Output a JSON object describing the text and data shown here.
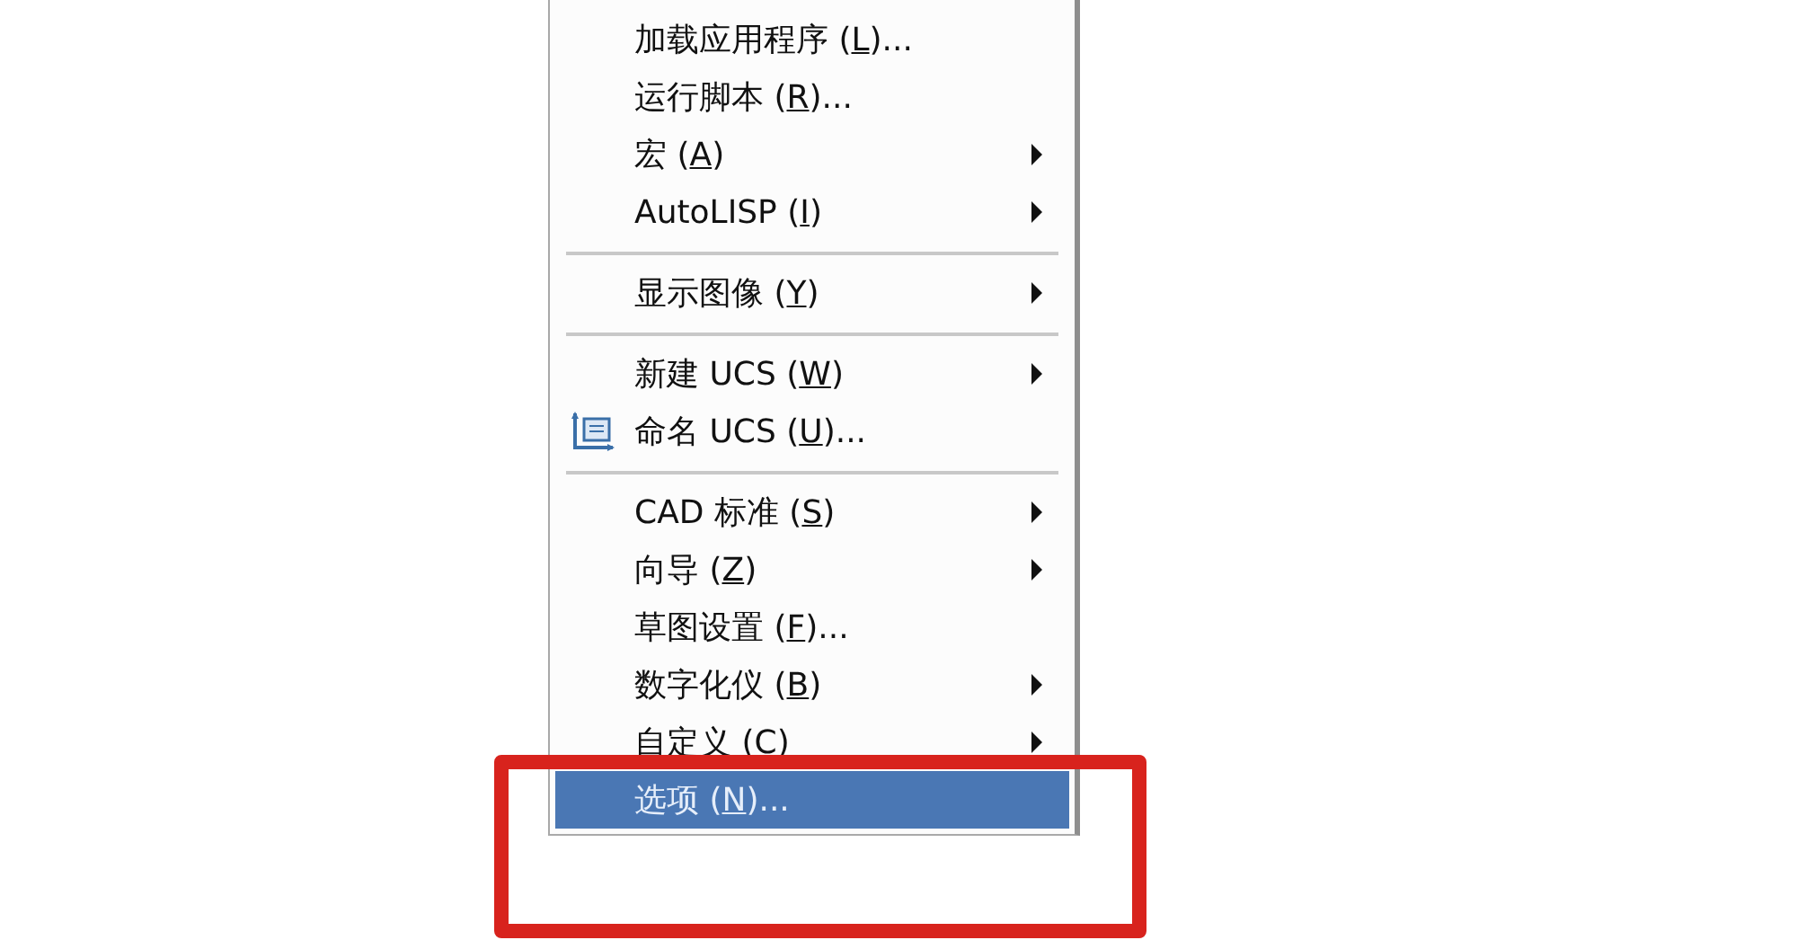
{
  "menu": {
    "items": [
      {
        "kind": "command",
        "text": "加载应用程序 (",
        "key": "L",
        "suffix": ")...",
        "icon": false,
        "selected": false
      },
      {
        "kind": "command",
        "text": "运行脚本 (",
        "key": "R",
        "suffix": ")...",
        "icon": false,
        "selected": false
      },
      {
        "kind": "submenu",
        "text": "宏 (",
        "key": "A",
        "suffix": ")",
        "icon": false,
        "selected": false
      },
      {
        "kind": "submenu",
        "text": "AutoLISP (",
        "key": "I",
        "suffix": ")",
        "icon": false,
        "selected": false
      },
      {
        "kind": "separator"
      },
      {
        "kind": "submenu",
        "text": "显示图像 (",
        "key": "Y",
        "suffix": ")",
        "icon": false,
        "selected": false
      },
      {
        "kind": "separator"
      },
      {
        "kind": "submenu",
        "text": "新建 UCS (",
        "key": "W",
        "suffix": ")",
        "icon": false,
        "selected": false
      },
      {
        "kind": "command",
        "text": "命名 UCS (",
        "key": "U",
        "suffix": ")...",
        "icon": true,
        "selected": false
      },
      {
        "kind": "separator"
      },
      {
        "kind": "submenu",
        "text": "CAD 标准 (",
        "key": "S",
        "suffix": ")",
        "icon": false,
        "selected": false
      },
      {
        "kind": "submenu",
        "text": "向导 (",
        "key": "Z",
        "suffix": ")",
        "icon": false,
        "selected": false
      },
      {
        "kind": "command",
        "text": "草图设置 (",
        "key": "F",
        "suffix": ")...",
        "icon": false,
        "selected": false
      },
      {
        "kind": "submenu",
        "text": "数字化仪 (",
        "key": "B",
        "suffix": ")",
        "icon": false,
        "selected": false
      },
      {
        "kind": "submenu",
        "text": "自定义 (",
        "key": "C",
        "suffix": ")",
        "icon": false,
        "selected": false
      },
      {
        "kind": "command",
        "text": "选项 (",
        "key": "N",
        "suffix": ")...",
        "icon": false,
        "selected": true
      }
    ]
  },
  "annotation": {
    "kind": "highlight-frame"
  }
}
